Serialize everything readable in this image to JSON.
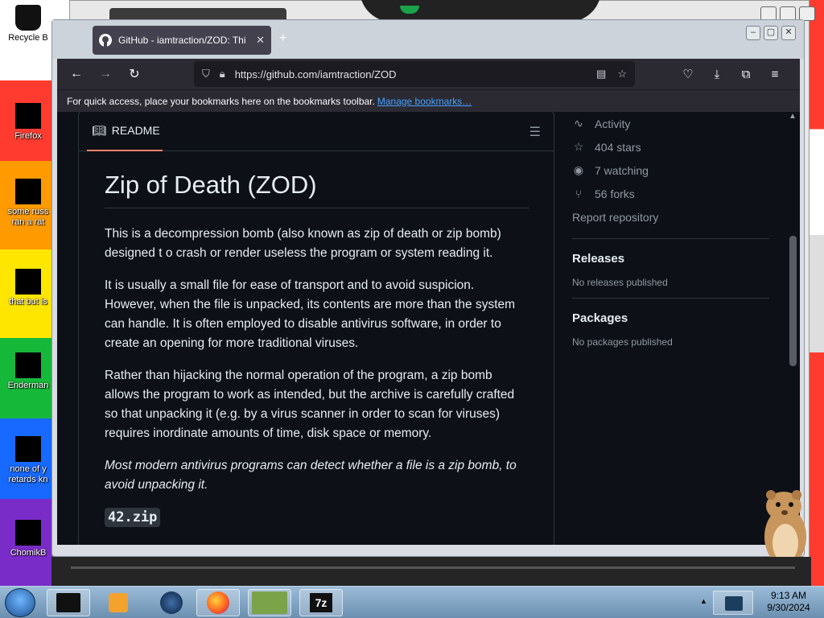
{
  "desktop": {
    "icons": [
      {
        "label": "Recycle B"
      },
      {
        "label": "Firefox"
      },
      {
        "label": "some russ ran a rat"
      },
      {
        "label": "that but is"
      },
      {
        "label": "Enderman"
      },
      {
        "label": "none of y retards kn"
      },
      {
        "label": "ChomikB"
      }
    ]
  },
  "browser": {
    "tab_title": "GitHub - iamtraction/ZOD: Thi",
    "tab_close": "✕",
    "new_tab": "+",
    "url": "https://github.com/iamtraction/ZOD",
    "bookmarks_bar_text": "For quick access, place your bookmarks here on the bookmarks toolbar.",
    "manage_bookmarks": "Manage bookmarks…"
  },
  "readme": {
    "tab_label": "README",
    "title": "Zip of Death (ZOD)",
    "paragraphs": [
      "This is a decompression bomb (also known as zip of death or zip bomb) designed t o crash or render useless the program or system reading it.",
      "It is usually a small file for ease of transport and to avoid suspicion. However, when the file is unpacked, its contents are more than the system can handle. It is often employed to disable antivirus software, in order to create an opening for more traditional viruses.",
      "Rather than hijacking the normal operation of the program, a zip bomb allows the program to work as intended, but the archive is carefully crafted so that unpacking it (e.g. by a virus scanner in order to scan for viruses) requires inordinate amounts of time, disk space or memory."
    ],
    "italic_paragraph": "Most modern antivirus programs can detect whether a file is a zip bomb, to avoid unpacking it.",
    "subheading": "42.zip"
  },
  "sidebar": {
    "activity": "Activity",
    "stars": "404 stars",
    "watching": "7 watching",
    "forks": "56 forks",
    "report": "Report repository",
    "releases_heading": "Releases",
    "releases_text": "No releases published",
    "packages_heading": "Packages",
    "packages_text": "No packages published"
  },
  "taskbar": {
    "time": "9:13 AM",
    "date": "9/30/2024"
  }
}
